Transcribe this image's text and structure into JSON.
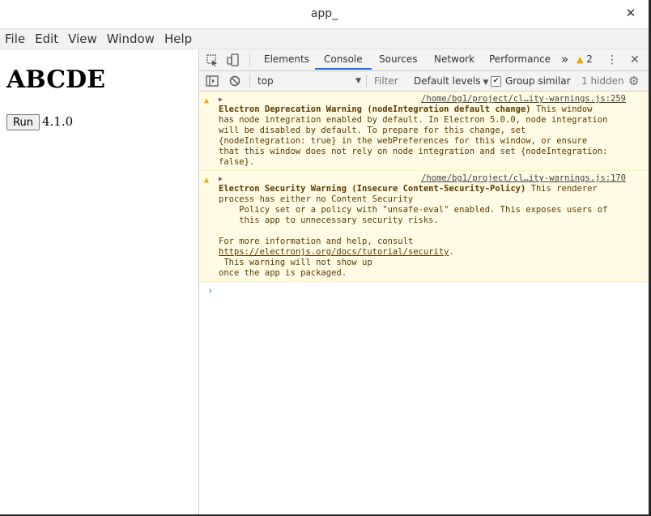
{
  "window": {
    "title": "app_",
    "close_glyph": "✕"
  },
  "menu": [
    "File",
    "Edit",
    "View",
    "Window",
    "Help"
  ],
  "app": {
    "heading": "ABCDE",
    "run_label": "Run",
    "version": "4.1.0"
  },
  "devtools": {
    "tabs": [
      "Elements",
      "Console",
      "Sources",
      "Network",
      "Performance"
    ],
    "active_tab": "Console",
    "more_tabs_glyph": "»",
    "warning_count": "2",
    "toolbar": {
      "context": "top",
      "filter_placeholder": "Filter",
      "levels": "Default levels",
      "group_similar": "Group similar",
      "hidden": "1 hidden"
    },
    "messages": [
      {
        "source": "/home/bg1/project/cl…ity-warnings.js:259",
        "title": "Electron Deprecation Warning (nodeIntegration default change)",
        "line1_rest": " This window",
        "lines": [
          "has node integration enabled by default. In Electron 5.0.0, node integration",
          "will be disabled by default. To prepare for this change, set",
          "{nodeIntegration: true} in the webPreferences for this window, or ensure",
          "that this window does not rely on node integration and set {nodeIntegration:",
          "false}."
        ]
      },
      {
        "source": "/home/bg1/project/cl…ity-warnings.js:170",
        "title": "Electron Security Warning (Insecure Content-Security-Policy)",
        "line1_rest": " This renderer",
        "lines": [
          "process has either no Content Security",
          "    Policy set or a policy with \"unsafe-eval\" enabled. This exposes users of",
          "    this app to unnecessary security risks.",
          "",
          "For more information and help, consult"
        ],
        "link": "https://electronjs.org/docs/tutorial/security",
        "link_suffix": ".",
        "tail": [
          " This warning will not show up",
          "once the app is packaged."
        ]
      }
    ],
    "prompt": "›"
  },
  "colors": {
    "accent": "#1a73e8",
    "warning_bg": "#fffbe5",
    "warning_icon": "#f0a500"
  }
}
